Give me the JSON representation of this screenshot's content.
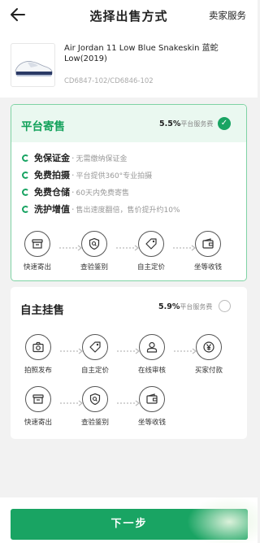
{
  "header": {
    "title": "选择出售方式",
    "service_link": "卖家服务",
    "back_icon": "back-arrow-icon"
  },
  "product": {
    "name": "Air Jordan 11 Low Blue Snakeskin 蓝蛇 Low(2019)",
    "code": "CD6847-102/CD6846-102"
  },
  "platform": {
    "title": "平台寄售",
    "fee_rate": "5.5%",
    "fee_text": "平台服务费",
    "selected": true,
    "benefits": [
      {
        "title": "免保证金",
        "desc": "无需缴纳保证金"
      },
      {
        "title": "免费拍摄",
        "desc": "平台提供360°专业拍摄"
      },
      {
        "title": "免费仓储",
        "desc": "60天内免费寄售"
      },
      {
        "title": "洗护增值",
        "desc": "售出速度翻倍，售价提升约10%"
      }
    ],
    "steps": [
      {
        "label": "快速寄出",
        "icon": "box-icon"
      },
      {
        "label": "查验鉴别",
        "icon": "shield-search-icon"
      },
      {
        "label": "自主定价",
        "icon": "price-tag-icon"
      },
      {
        "label": "坐等收钱",
        "icon": "wallet-icon"
      }
    ]
  },
  "self": {
    "title": "自主挂售",
    "fee_rate": "5.9%",
    "fee_text": "平台服务费",
    "selected": false,
    "steps_row1": [
      {
        "label": "拍照发布",
        "icon": "camera-icon"
      },
      {
        "label": "自主定价",
        "icon": "price-tag-icon"
      },
      {
        "label": "在线审核",
        "icon": "reviewer-icon"
      },
      {
        "label": "买家付款",
        "icon": "yen-coin-icon"
      }
    ],
    "steps_row2": [
      {
        "label": "快速寄出",
        "icon": "box-icon"
      },
      {
        "label": "查验鉴别",
        "icon": "shield-search-icon"
      },
      {
        "label": "坐等收钱",
        "icon": "wallet-icon"
      }
    ]
  },
  "footer": {
    "next_label": "下一步"
  },
  "colors": {
    "accent": "#19a463",
    "accent_light": "#eaf8f0",
    "border_selected": "#7fd3a4"
  }
}
